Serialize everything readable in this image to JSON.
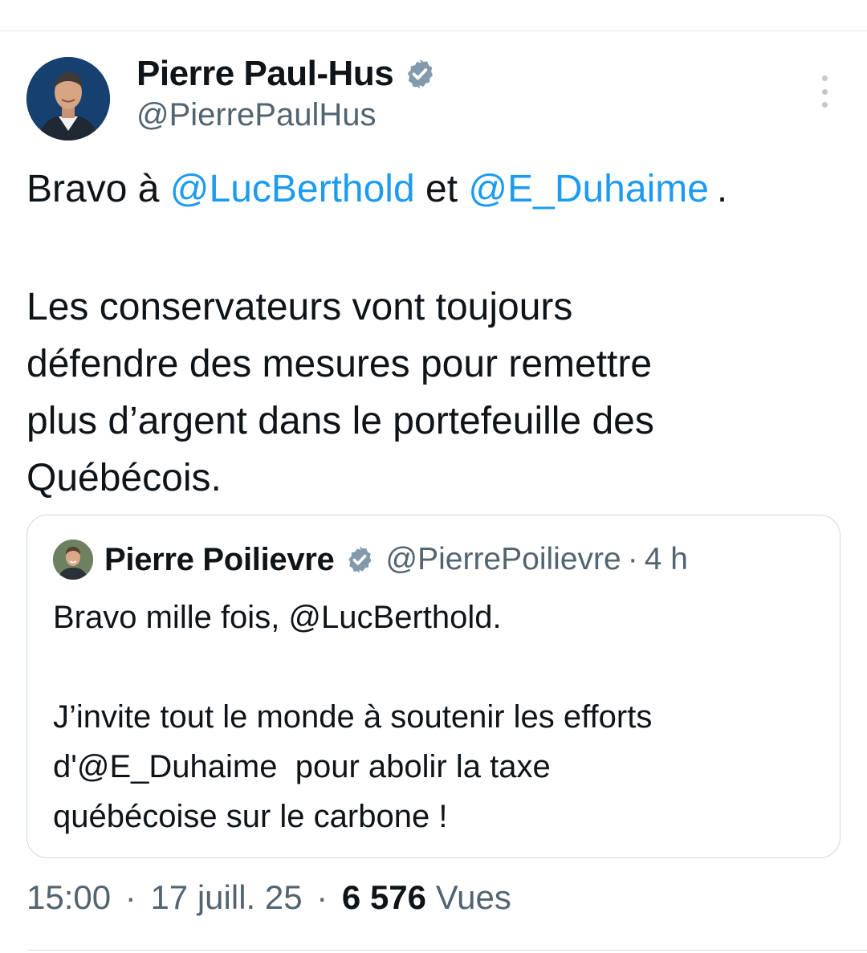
{
  "tweet": {
    "author": {
      "name": "Pierre Paul-Hus",
      "handle": "@PierrePaulHus",
      "avatar_icon": "profile-photo",
      "verified_icon": "verified-badge-icon",
      "verified_color": "#829aab"
    },
    "more_icon": "more-vertical-icon",
    "text": {
      "line1_prefix": "Bravo à ",
      "mention1": "@LucBerthold",
      "line1_middle": " et ",
      "mention2": "@E_Duhaime",
      "line1_suffix": ".",
      "paragraph": [
        "Les conservateurs vont toujours",
        "défendre des mesures pour remettre",
        "plus d’argent dans le portefeuille des",
        "Québécois."
      ]
    },
    "quote": {
      "author_name": "Pierre Poilievre",
      "author_handle": "@PierrePoilievre",
      "separator": "·",
      "time": "4 h",
      "lines": [
        "Bravo mille fois, @LucBerthold.",
        "",
        "J’invite tout le monde à soutenir les efforts",
        "d'@E_Duhaime  pour abolir la taxe",
        "québécoise sur le carbone !"
      ]
    },
    "footer": {
      "time": "15:00",
      "separator": "·",
      "date": "17 juill. 25",
      "views_count": "6 576",
      "views_label": "Vues"
    },
    "colors": {
      "text": "#0f1419",
      "secondary": "#536471",
      "link": "#1d9bf0",
      "border": "#cfd9de"
    }
  }
}
